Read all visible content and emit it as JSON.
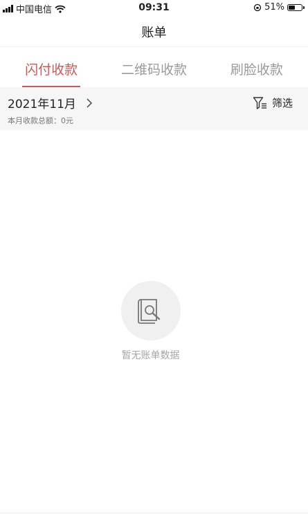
{
  "status_bar": {
    "carrier": "中国电信",
    "time": "09:31",
    "battery": "51%",
    "battery_level": 0.51
  },
  "navbar": {
    "title": "账单"
  },
  "tabs": [
    {
      "label": "闪付收款",
      "active": true
    },
    {
      "label": "二维码收款",
      "active": false
    },
    {
      "label": "刷脸收款",
      "active": false
    }
  ],
  "month_bar": {
    "month": "2021年11月",
    "total": "本月收款总额：0元",
    "filter_label": "筛选"
  },
  "empty_state": {
    "message": "暂无账单数据",
    "icon": "document-search-icon"
  },
  "colors": {
    "accent": "#c95a55",
    "muted": "#9a9a9a",
    "background_alt": "#f6f6f6"
  }
}
